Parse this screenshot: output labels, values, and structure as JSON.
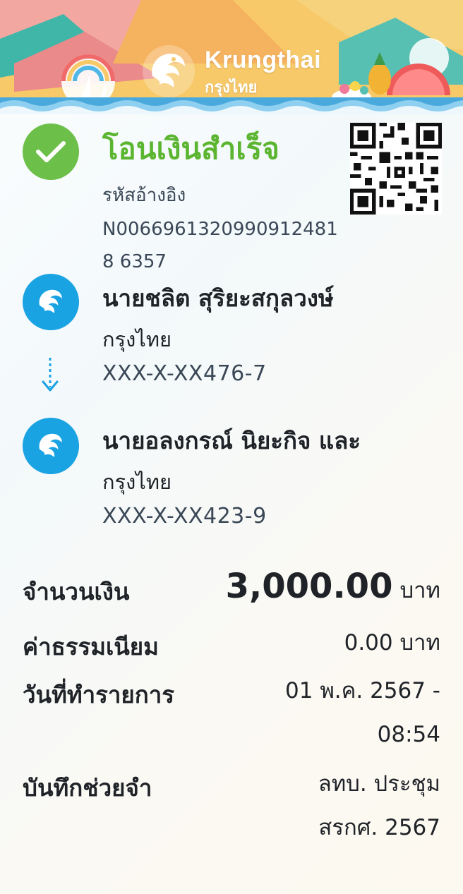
{
  "header": {
    "brand_name": "Krungthai",
    "brand_thai": "กรุงไทย"
  },
  "status": {
    "title": "โอนเงินสำเร็จ",
    "ref_label": "รหัสอ้างอิง",
    "ref_value": "N00669613209909124818 6357"
  },
  "sender": {
    "name": "นายชลิต สุริยะสกุลวงษ์",
    "bank": "กรุงไทย",
    "account": "XXX-X-XX476-7"
  },
  "receiver": {
    "name": "นายอลงกรณ์ นิยะกิจ และ",
    "bank": "กรุงไทย",
    "account": "XXX-X-XX423-9"
  },
  "details": {
    "amount_label": "จำนวนเงิน",
    "amount_value": "3,000.00",
    "amount_unit": "บาท",
    "fee_label": "ค่าธรรมเนียม",
    "fee_value": "0.00 บาท",
    "date_label": "วันที่ทำรายการ",
    "date_value_line1": "01 พ.ค. 2567 -",
    "date_value_line2": "08:54",
    "memo_label": "บันทึกช่วยจำ",
    "memo_value_line1": "ลทบ. ประชุม",
    "memo_value_line2": "สรกศ. 2567"
  },
  "colors": {
    "success": "#6cc04a",
    "brand_blue": "#1aa3e3"
  }
}
